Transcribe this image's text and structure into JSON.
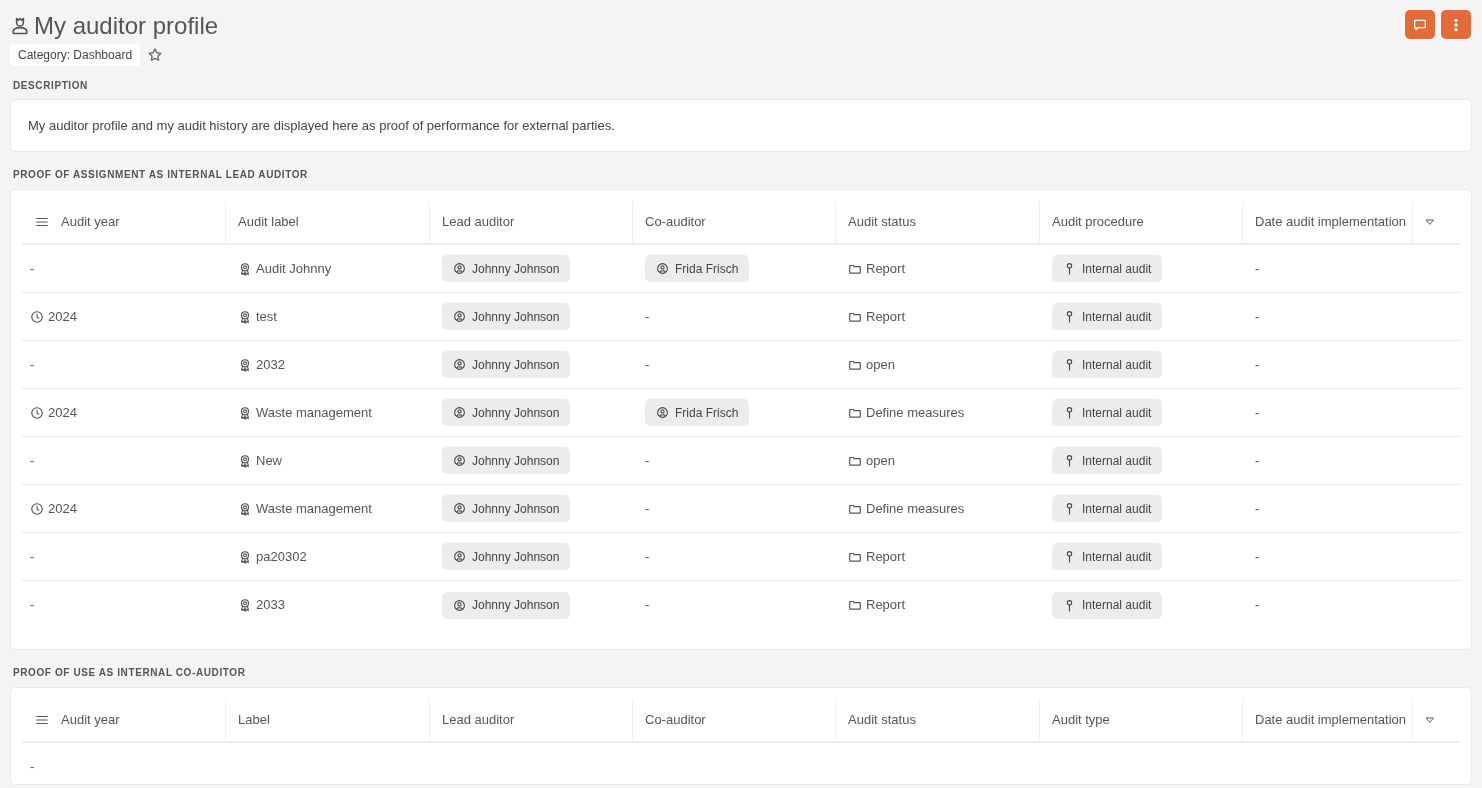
{
  "page": {
    "title": "My auditor profile",
    "category": "Category: Dashboard"
  },
  "description": {
    "heading": "DESCRIPTION",
    "text": "My auditor profile and my audit history are displayed here as proof of performance for external parties."
  },
  "tables": [
    {
      "heading": "PROOF OF ASSIGNMENT AS INTERNAL LEAD AUDITOR",
      "columns": [
        "Audit year",
        "Audit label",
        "Lead auditor",
        "Co-auditor",
        "Audit status",
        "Audit procedure",
        "Date audit implementation"
      ],
      "rows": [
        {
          "cells": [
            {
              "kind": "plain",
              "text": "-"
            },
            {
              "kind": "award",
              "text": "Audit Johnny"
            },
            {
              "kind": "person",
              "text": "Johnny Johnson"
            },
            {
              "kind": "person",
              "text": "Frida Frisch"
            },
            {
              "kind": "folder",
              "text": "Report"
            },
            {
              "kind": "procedure",
              "text": "Internal audit"
            },
            {
              "kind": "plain",
              "text": "-"
            }
          ]
        },
        {
          "cells": [
            {
              "kind": "time",
              "text": "2024"
            },
            {
              "kind": "award",
              "text": "test"
            },
            {
              "kind": "person",
              "text": "Johnny Johnson"
            },
            {
              "kind": "plain",
              "text": "-"
            },
            {
              "kind": "folder",
              "text": "Report"
            },
            {
              "kind": "procedure",
              "text": "Internal audit"
            },
            {
              "kind": "plain",
              "text": "-"
            }
          ]
        },
        {
          "cells": [
            {
              "kind": "plain",
              "text": "-"
            },
            {
              "kind": "award",
              "text": "2032"
            },
            {
              "kind": "person",
              "text": "Johnny Johnson"
            },
            {
              "kind": "plain",
              "text": "-"
            },
            {
              "kind": "folder",
              "text": "open"
            },
            {
              "kind": "procedure",
              "text": "Internal audit"
            },
            {
              "kind": "plain",
              "text": "-"
            }
          ]
        },
        {
          "cells": [
            {
              "kind": "time",
              "text": "2024"
            },
            {
              "kind": "award",
              "text": "Waste management"
            },
            {
              "kind": "person",
              "text": "Johnny Johnson"
            },
            {
              "kind": "person",
              "text": "Frida Frisch"
            },
            {
              "kind": "folder",
              "text": "Define measures"
            },
            {
              "kind": "procedure",
              "text": "Internal audit"
            },
            {
              "kind": "plain",
              "text": "-"
            }
          ]
        },
        {
          "cells": [
            {
              "kind": "plain",
              "text": "-"
            },
            {
              "kind": "award",
              "text": "New"
            },
            {
              "kind": "person",
              "text": "Johnny Johnson"
            },
            {
              "kind": "plain",
              "text": "-"
            },
            {
              "kind": "folder",
              "text": "open"
            },
            {
              "kind": "procedure",
              "text": "Internal audit"
            },
            {
              "kind": "plain",
              "text": "-"
            }
          ]
        },
        {
          "cells": [
            {
              "kind": "time",
              "text": "2024"
            },
            {
              "kind": "award",
              "text": "Waste management"
            },
            {
              "kind": "person",
              "text": "Johnny Johnson"
            },
            {
              "kind": "plain",
              "text": "-"
            },
            {
              "kind": "folder",
              "text": "Define measures"
            },
            {
              "kind": "procedure",
              "text": "Internal audit"
            },
            {
              "kind": "plain",
              "text": "-"
            }
          ]
        },
        {
          "cells": [
            {
              "kind": "plain",
              "text": "-"
            },
            {
              "kind": "award",
              "text": "pa20302"
            },
            {
              "kind": "person",
              "text": "Johnny Johnson"
            },
            {
              "kind": "plain",
              "text": "-"
            },
            {
              "kind": "folder",
              "text": "Report"
            },
            {
              "kind": "procedure",
              "text": "Internal audit"
            },
            {
              "kind": "plain",
              "text": "-"
            }
          ]
        },
        {
          "cells": [
            {
              "kind": "plain",
              "text": "-"
            },
            {
              "kind": "award",
              "text": "2033"
            },
            {
              "kind": "person",
              "text": "Johnny Johnson"
            },
            {
              "kind": "plain",
              "text": "-"
            },
            {
              "kind": "folder",
              "text": "Report"
            },
            {
              "kind": "procedure",
              "text": "Internal audit"
            },
            {
              "kind": "plain",
              "text": "-"
            }
          ]
        }
      ]
    },
    {
      "heading": "PROOF OF USE AS INTERNAL CO-AUDITOR",
      "columns": [
        "Audit year",
        "Label",
        "Lead auditor",
        "Co-auditor",
        "Audit status",
        "Audit type",
        "Date audit implementation"
      ],
      "rows": [
        {
          "cells": [
            {
              "kind": "plain",
              "text": "-"
            }
          ]
        }
      ]
    }
  ]
}
